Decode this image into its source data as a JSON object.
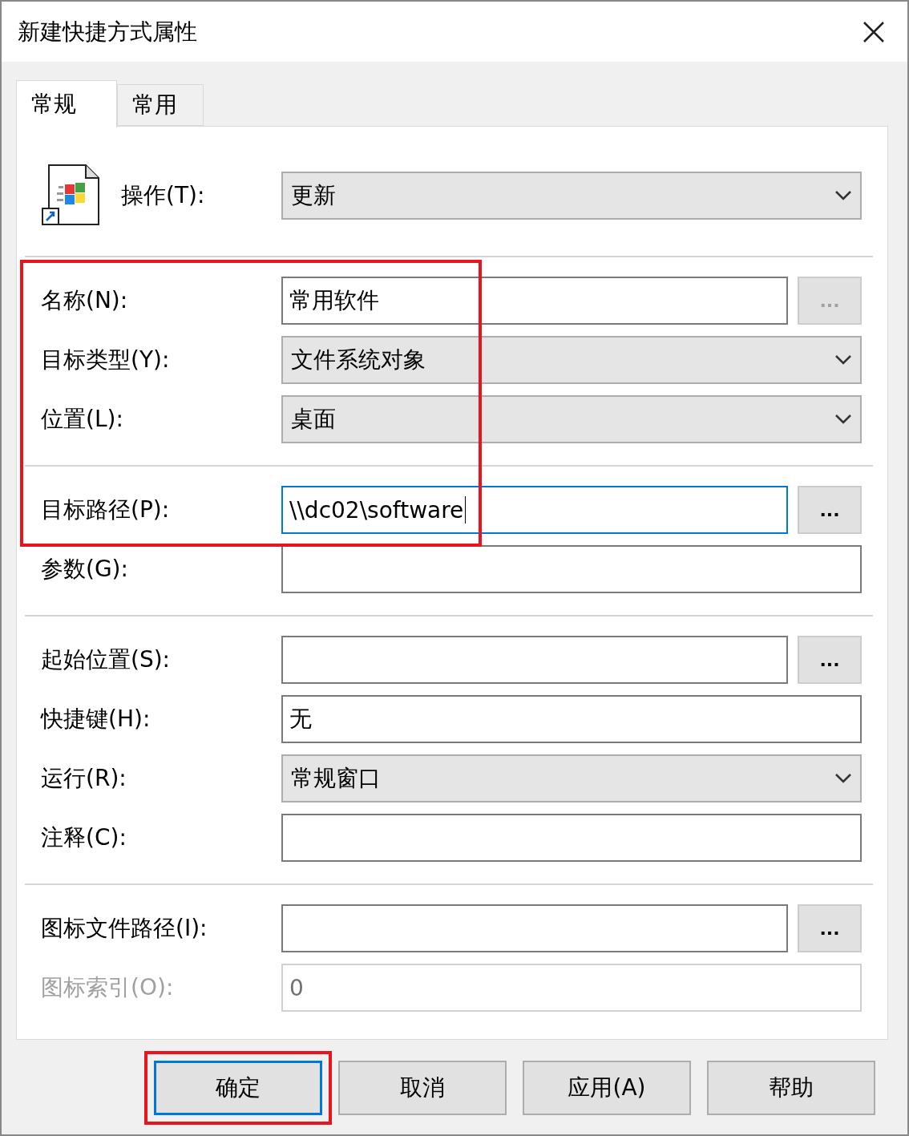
{
  "window": {
    "title": "新建快捷方式属性"
  },
  "tabs": [
    {
      "label": "常规",
      "selected": true
    },
    {
      "label": "常用",
      "selected": false
    }
  ],
  "highlight_frame": true,
  "groups": [
    {
      "kind": "action",
      "rows": [
        {
          "kind": "combo",
          "label": "操作(T):",
          "value": "更新"
        }
      ]
    },
    {
      "kind": "fields",
      "rows": [
        {
          "kind": "browse",
          "label": "名称(N):",
          "value": "常用软件",
          "focused": false,
          "disabled": false,
          "browse_disabled": true
        },
        {
          "kind": "combo",
          "label": "目标类型(Y):",
          "value": "文件系统对象"
        },
        {
          "kind": "combo",
          "label": "位置(L):",
          "value": "桌面"
        }
      ]
    },
    {
      "kind": "fields",
      "rows": [
        {
          "kind": "browse",
          "label": "目标路径(P):",
          "value": "\\\\dc02\\software",
          "focused": true,
          "disabled": false,
          "browse_disabled": false
        },
        {
          "kind": "text",
          "label": "参数(G):",
          "value": "",
          "focused": false,
          "disabled": false
        }
      ]
    },
    {
      "kind": "fields",
      "rows": [
        {
          "kind": "browse",
          "label": "起始位置(S):",
          "value": "",
          "focused": false,
          "disabled": false,
          "browse_disabled": false
        },
        {
          "kind": "text",
          "label": "快捷键(H):",
          "value": "无",
          "focused": false,
          "disabled": false
        },
        {
          "kind": "combo",
          "label": "运行(R):",
          "value": "常规窗口"
        },
        {
          "kind": "text",
          "label": "注释(C):",
          "value": "",
          "focused": false,
          "disabled": false
        }
      ]
    },
    {
      "kind": "fields",
      "rows": [
        {
          "kind": "browse",
          "label": "图标文件路径(I):",
          "value": "",
          "focused": false,
          "disabled": false,
          "browse_disabled": false
        },
        {
          "kind": "text",
          "label": "图标索引(O):",
          "value": "0",
          "focused": false,
          "disabled": true
        }
      ]
    }
  ],
  "browse_label": "...",
  "buttons": [
    {
      "label": "确定",
      "default": true,
      "highlighted": true
    },
    {
      "label": "取消",
      "default": false,
      "highlighted": false
    },
    {
      "label": "应用(A)",
      "default": false,
      "highlighted": false
    },
    {
      "label": "帮助",
      "default": false,
      "highlighted": false
    }
  ]
}
